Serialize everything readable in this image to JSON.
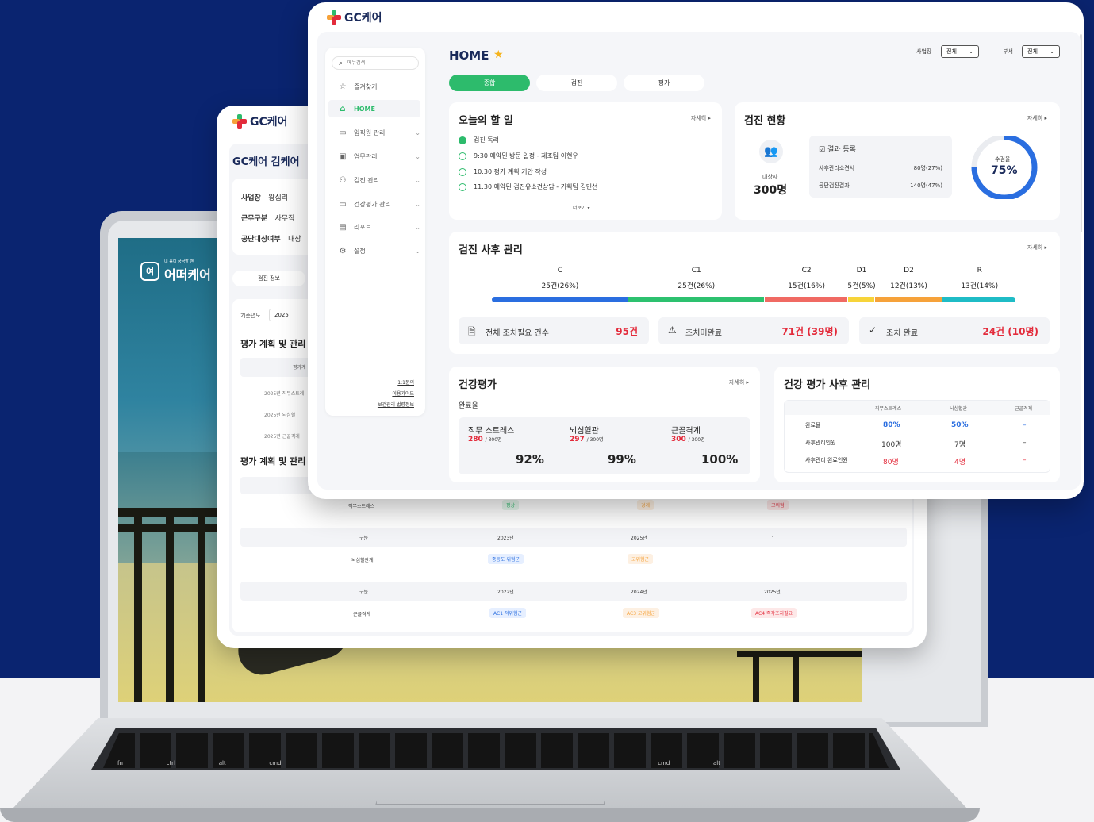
{
  "app": {
    "brand": "GC케어"
  },
  "colors": {
    "navy_bg": "#0a2470",
    "green": "#2dbb6c",
    "blue": "#2a6ee0",
    "red": "#e32b3b",
    "teal": "#1fbcc6",
    "orange": "#f6a23a",
    "yellow": "#f7d43a",
    "salmon": "#f06a63"
  },
  "front": {
    "header": {
      "title": "HOME",
      "workplace_label": "사업장",
      "workplace_value": "전체",
      "dept_label": "부서",
      "dept_value": "전체"
    },
    "tabs": [
      {
        "label": "종합"
      },
      {
        "label": "검진"
      },
      {
        "label": "평가"
      }
    ],
    "sidebar": {
      "search_placeholder": "메뉴검색",
      "items": [
        {
          "label": "즐겨찾기",
          "icon": "star-icon"
        },
        {
          "label": "HOME",
          "icon": "home-icon"
        },
        {
          "label": "임직원 관리",
          "icon": "folder-icon"
        },
        {
          "label": "업무관리",
          "icon": "briefcase-icon"
        },
        {
          "label": "검진 관리",
          "icon": "group-icon"
        },
        {
          "label": "건강평가 관리",
          "icon": "folder-icon"
        },
        {
          "label": "리포트",
          "icon": "report-icon"
        },
        {
          "label": "설정",
          "icon": "gear-icon"
        }
      ],
      "footer_links": [
        "1:1문의",
        "이용가이드",
        "보건관리 법령정보"
      ]
    },
    "todo": {
      "title": "오늘의 할 일",
      "more": "자세히",
      "items": [
        {
          "text": "검진 독려",
          "done": true
        },
        {
          "text": "9:30 예약된 방문 일정 - 제조팀 이현우",
          "done": false
        },
        {
          "text": "10:30 평가 계획 기안 작성",
          "done": false
        },
        {
          "text": "11:30 예약된 검진유소견상담 - 기획팀 김민선",
          "done": false
        }
      ],
      "show_more": "더보기"
    },
    "checkup_status": {
      "title": "검진 현황",
      "more": "자세히",
      "target_label": "대상자",
      "target_value": "300명",
      "result_title": "결과 등록",
      "rows": [
        {
          "label": "사후관리소견서",
          "value": "80명(27%)"
        },
        {
          "label": "공단검진결과",
          "value": "140명(47%)"
        }
      ],
      "donut_label": "수검율",
      "donut_value": "75%",
      "donut_fraction": 0.75
    },
    "followup": {
      "title": "검진 사후 관리",
      "more": "자세히",
      "groups": [
        {
          "name": "C",
          "value": "25건(26%)",
          "pct": 26,
          "color": "#2a6ee0"
        },
        {
          "name": "C1",
          "value": "25건(26%)",
          "pct": 26,
          "color": "#2dc16f"
        },
        {
          "name": "C2",
          "value": "15건(16%)",
          "pct": 16,
          "color": "#f06a63"
        },
        {
          "name": "D1",
          "value": "5건(5%)",
          "pct": 5,
          "color": "#f7d43a"
        },
        {
          "name": "D2",
          "value": "12건(13%)",
          "pct": 13,
          "color": "#f6a23a"
        },
        {
          "name": "R",
          "value": "13건(14%)",
          "pct": 14,
          "color": "#1fbcc6"
        }
      ],
      "stats": [
        {
          "label": "전체 조치필요 건수",
          "value": "95건",
          "icon": "document-icon"
        },
        {
          "label": "조치미완료",
          "value": "71건 (39명)",
          "icon": "warning-icon"
        },
        {
          "label": "조치 완료",
          "value": "24건 (10명)",
          "icon": "check-circle-icon"
        }
      ]
    },
    "health_eval": {
      "title": "건강평가",
      "more": "자세히",
      "subtitle": "완료율",
      "items": [
        {
          "name": "직무 스트레스",
          "count": "280",
          "total": "/ 300명",
          "pct": "92%"
        },
        {
          "name": "뇌심혈관",
          "count": "297",
          "total": "/ 300명",
          "pct": "99%"
        },
        {
          "name": "근골격계",
          "count": "300",
          "total": "/ 300명",
          "pct": "100%"
        }
      ]
    },
    "health_followup": {
      "title": "건강 평가 사후 관리",
      "columns": [
        "직무스트레스",
        "뇌심혈관",
        "근골격계"
      ],
      "rows": [
        {
          "label": "완료율",
          "values": [
            "80%",
            "50%",
            "–"
          ]
        },
        {
          "label": "사후관리인원",
          "values": [
            "100명",
            "7명",
            "–"
          ]
        },
        {
          "label": "사후관리 완료인원",
          "values": [
            "80명",
            "4명",
            "–"
          ]
        }
      ]
    }
  },
  "back": {
    "title": "GC케어 김케어",
    "info": [
      {
        "label": "사업장",
        "value": "왕십리"
      },
      {
        "label": "근무구분",
        "value": "사무직"
      },
      {
        "label": "공단대상여부",
        "value": "대상"
      }
    ],
    "tab": "검진 정보",
    "year_label": "기준년도",
    "year_value": "2025",
    "section1": "평가 계획 및 관리",
    "head_cell": "평가계",
    "plans": [
      "2025년 직무스트레",
      "2025년 뇌심혈",
      "2025년 근골격계"
    ],
    "section2": "평가 계획 및 관리",
    "stress_label": "직무스트레스",
    "stress_tags": [
      "정상",
      "경계",
      "고위험"
    ],
    "t2_head": [
      "구분",
      "2023년",
      "2025년",
      "-"
    ],
    "t2_row_label": "뇌심혈관계",
    "t2_tags": [
      "중등도 위험군",
      "고위험군"
    ],
    "t3_head": [
      "구분",
      "2022년",
      "2024년",
      "2025년"
    ],
    "t3_row_label": "근골격계",
    "t3_tags": [
      "AC1 저위험군",
      "AC3 고위험군",
      "AC4 즉각조치필요"
    ]
  },
  "laptop": {
    "screen_brand": "어떠케어",
    "screen_small": "내 몸이 궁금할 땐",
    "key_labels": [
      "fn",
      "ctrl",
      "alt",
      "cmd",
      "cmd",
      "alt"
    ]
  }
}
